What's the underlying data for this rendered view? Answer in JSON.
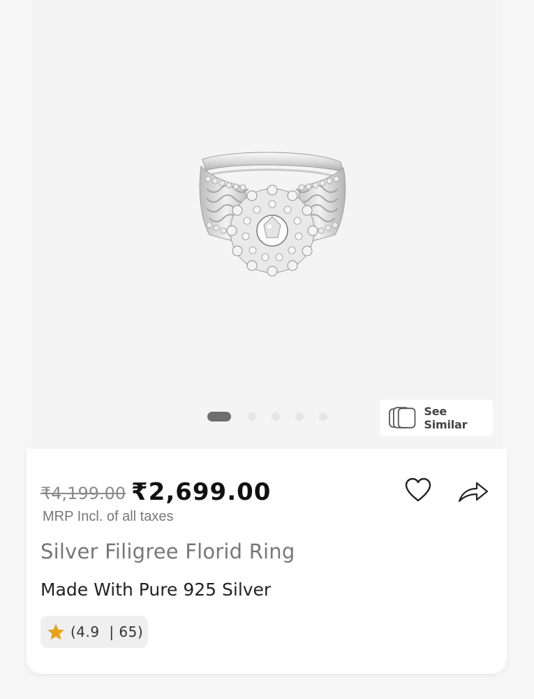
{
  "gallery": {
    "product_image": "silver-filigree-ring",
    "slide_count": 5,
    "active_slide": 1,
    "see_similar_label": "See Similar",
    "see_similar_icon": "stacked-cards-icon"
  },
  "pricing": {
    "mrp": "₹4,199.00",
    "price": "₹2,699.00",
    "mrp_note": "MRP Incl. of all taxes"
  },
  "actions": {
    "wishlist_icon": "heart-outline-icon",
    "share_icon": "share-arrow-icon"
  },
  "product": {
    "title": "Silver Filigree Florid Ring",
    "subtitle": "Made With Pure 925 Silver"
  },
  "rating": {
    "text": "(4.9  | 65)",
    "value": 4.9,
    "count": 65,
    "star_color": "#e5a117"
  }
}
